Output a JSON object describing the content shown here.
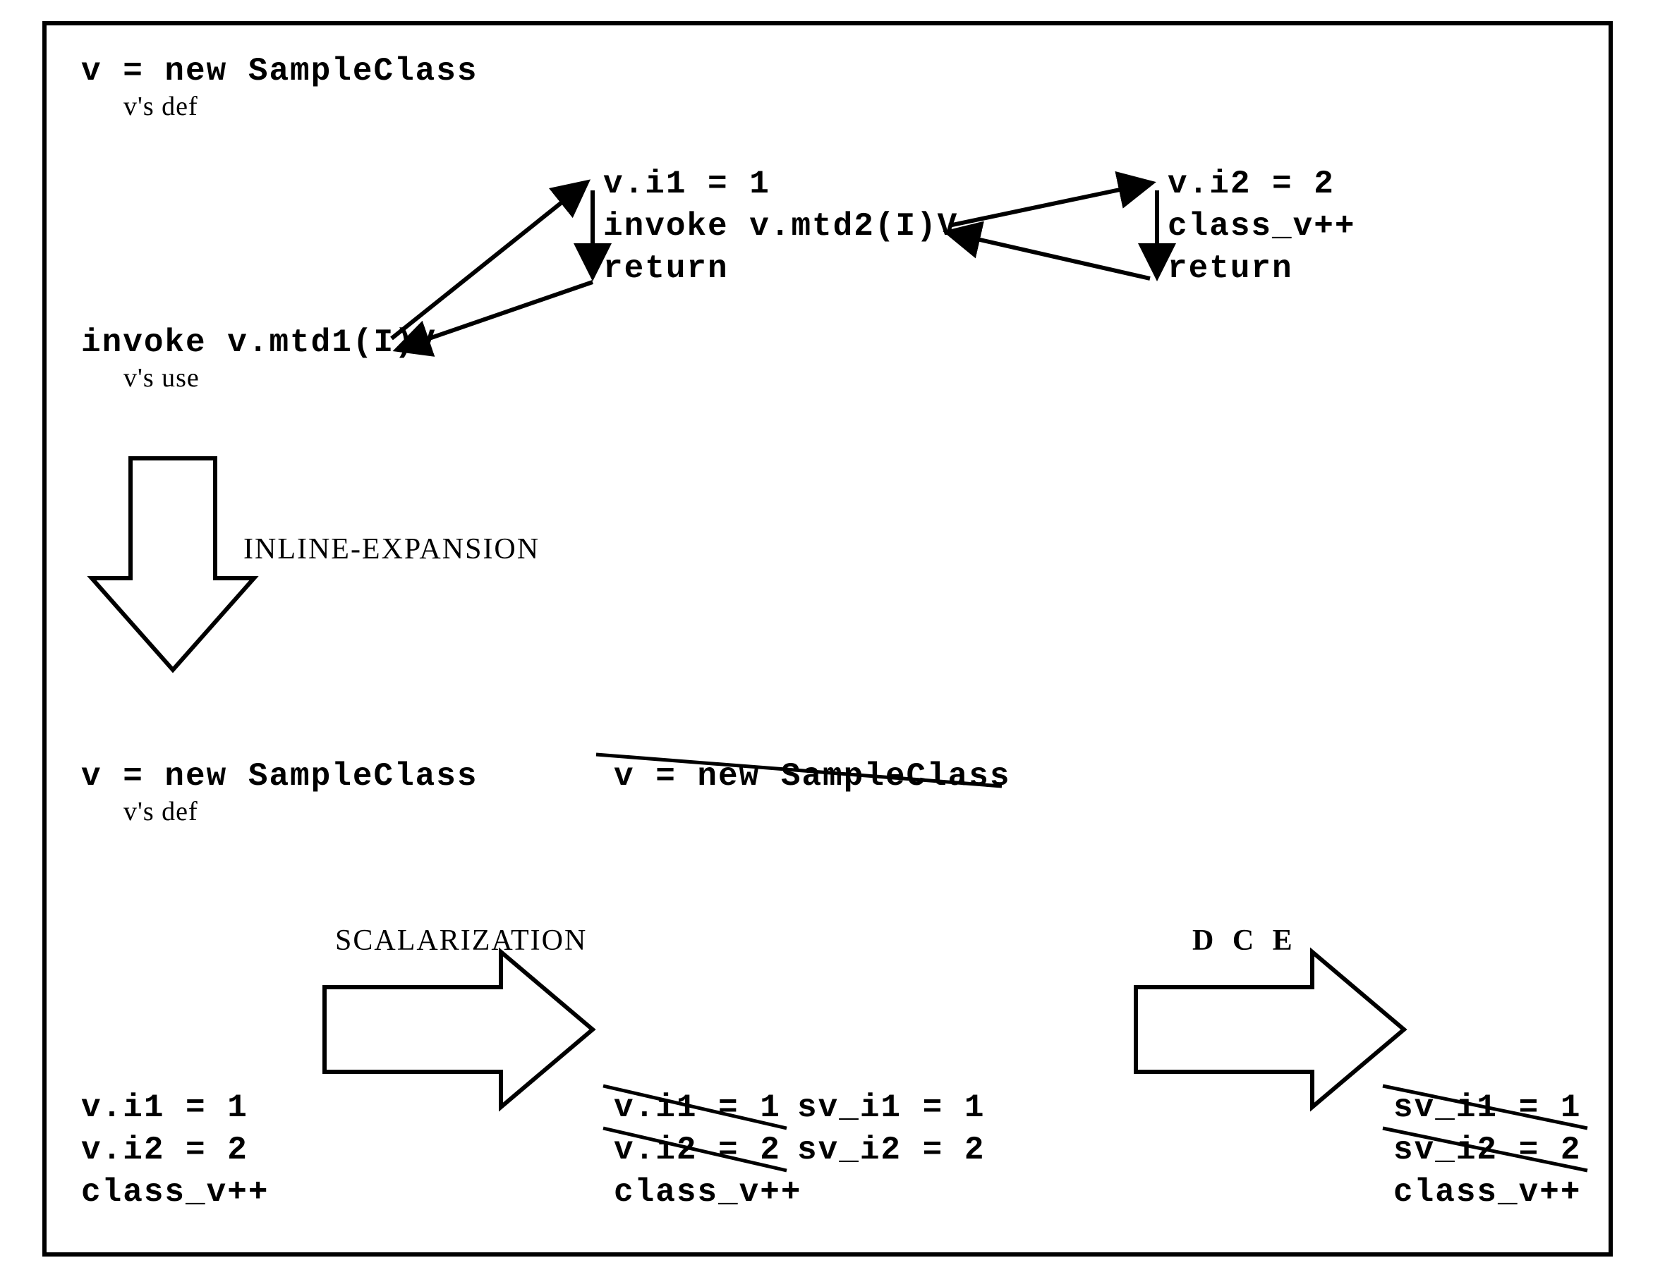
{
  "top": {
    "decl": "v = new SampleClass",
    "decl_note": "v's def",
    "invoke1": "invoke v.mtd1(I)V",
    "invoke1_note": "v's use",
    "block1_l1": "v.i1 = 1",
    "block1_l2": "invoke v.mtd2(I)V",
    "block1_l3": "return",
    "block2_l1": "v.i2 = 2",
    "block2_l2": "class_v++",
    "block2_l3": "return"
  },
  "steps": {
    "inline": "INLINE-EXPANSION",
    "scalar": "SCALARIZATION",
    "dce": "D C E"
  },
  "mid": {
    "decl": "v = new SampleClass",
    "decl_note": "v's def",
    "decl_struck": "v = new SampleClass",
    "left_l1": "v.i1 = 1",
    "left_l2": "v.i2 = 2",
    "left_l3": "class_v++",
    "center_struck_l1": "v.i1 = 1",
    "center_repl_l1": "sv_i1 = 1",
    "center_struck_l2": "v.i2 = 2",
    "center_repl_l2": "sv_i2 = 2",
    "center_l3": "class_v++",
    "right_struck_l1": "sv_i1 = 1",
    "right_struck_l2": "sv_i2 = 2",
    "right_l3": "class_v++"
  }
}
